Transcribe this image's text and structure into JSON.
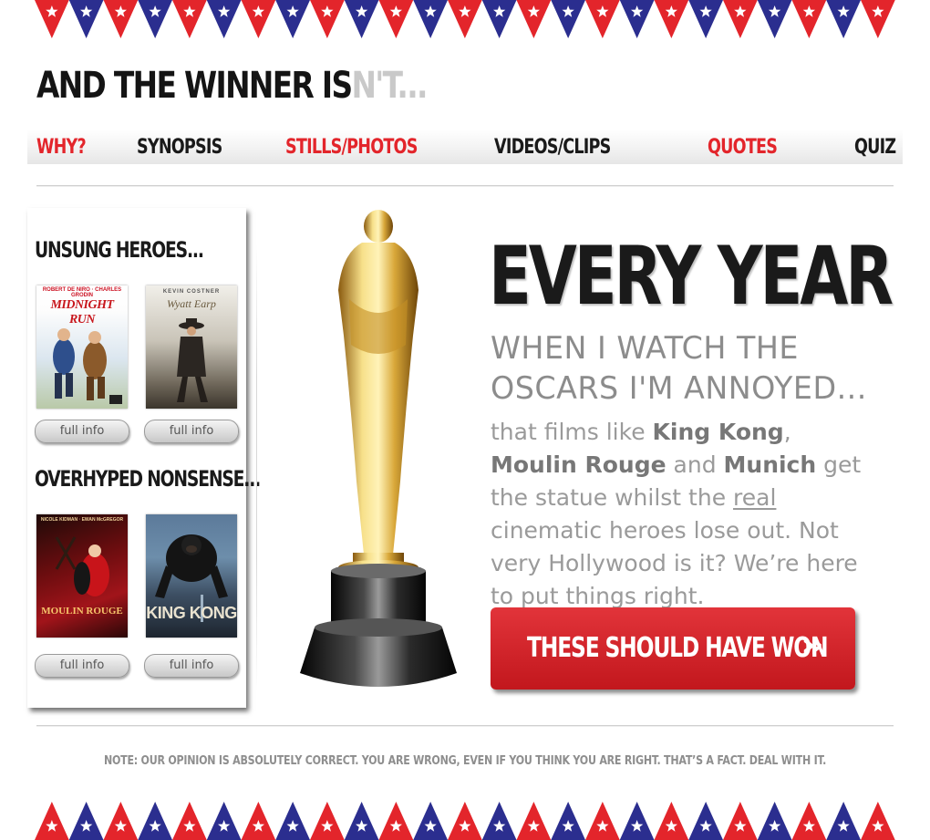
{
  "logo": {
    "main": "AND THE WINNER IS",
    "faint": "N'T..."
  },
  "nav": {
    "why": "WHY?",
    "synopsis": "SYNOPSIS",
    "stills": "STILLS/PHOTOS",
    "videos": "VIDEOS/CLIPS",
    "quotes": "QUOTES",
    "quiz": "QUIZ"
  },
  "colors": {
    "accent_red": "#e3252b",
    "bunting_red": "#e3252b",
    "bunting_blue": "#2b2e8f",
    "cta_red": "#d0242a"
  },
  "sidebar": {
    "unsung_heading": "UNSUNG HEROES...",
    "overhyped_heading": "OVERHYPED NONSENSE...",
    "full_info_label": "full info",
    "posters": [
      {
        "title": "MIDNIGHT RUN",
        "credits": "ROBERT DE NIRO · CHARLES GRODIN"
      },
      {
        "title": "Wyatt Earp",
        "credits": "KEVIN COSTNER"
      },
      {
        "title": "MOULIN ROUGE",
        "credits": "NICOLE KIDMAN · EWAN McGREGOR"
      },
      {
        "title": "KING KONG",
        "credits": ""
      }
    ]
  },
  "hero": {
    "title": "EVERY YEAR",
    "sub_line1": "WHEN I WATCH THE",
    "sub_line2": "OSCARS I'M ANNOYED...",
    "body": {
      "p1": "that films like ",
      "film1": "King Kong",
      "comma": ", ",
      "film2": "Moulin Rouge",
      "and": " and ",
      "film3": "Munich",
      "p2": " get the statue whilst the ",
      "real": "real",
      "p3": " cinematic heroes lose out. Not very Hollywood is it? We’re here to put things right."
    },
    "cta_label": "THESE SHOULD HAVE WON",
    "cta_arrow": "»"
  },
  "note": "NOTE: OUR OPINION IS ABSOLUTELY CORRECT. YOU ARE WRONG, EVEN IF YOU THINK YOU ARE RIGHT. THAT’S A FACT. DEAL WITH IT."
}
